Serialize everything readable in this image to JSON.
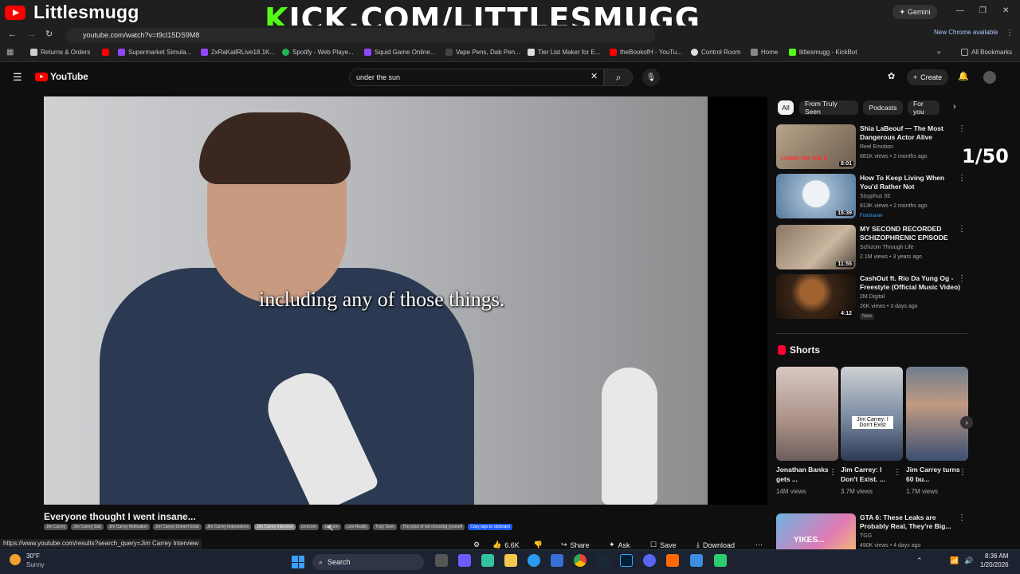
{
  "overlay": {
    "streamer": "Littlesmugg",
    "kick_prefix": "K",
    "kick_rest": "ICK.COM/LITTLESMUGG",
    "counter": "1/50"
  },
  "browser": {
    "url": "youtube.com/watch?v=t9cl15DS9M8",
    "gemini": "Gemini",
    "new_chrome": "New Chrome available",
    "all_bookmarks": "All Bookmarks",
    "bookmarks": [
      "Returns & Orders",
      "Supermarket Simula...",
      "2xRaKailRLive18.1K...",
      "Spotify - Web Playe...",
      "Squid Game Online...",
      "Vape Pens, Dab Pen...",
      "Tier List Maker for E...",
      "theBookofH - YouTu...",
      "Control Room",
      "Home",
      "littlesmugg - KickBot"
    ]
  },
  "youtube": {
    "logo": "YouTube",
    "search_value": "under the sun",
    "create_label": "Create",
    "subtitle": "including any of those things.",
    "video_title": "Everyone thought I went insane...",
    "tags": [
      "Jim Carrey",
      "Jim Carrey Sad",
      "Jim Carrey Motivation",
      "Jim Carrey Doesn't Exist",
      "Jim Carrey Impressions",
      "Jim Carrey Interview",
      "corecore",
      "sadcore",
      "Lost Reality",
      "Truly Seen",
      "The price of not choosing yourself",
      "Copy tags to clipboard"
    ],
    "status_url": "https://www.youtube.com/results?search_query=Jim Carrey Interview",
    "likes": "6.6K",
    "share": "Share",
    "ask": "Ask",
    "save": "Save",
    "download": "Download",
    "chips": [
      "All",
      "From Truly Seen",
      "Podcasts",
      "For you"
    ],
    "recs": [
      {
        "title": "Shia LaBeouf — The Most Dangerous Actor Alive",
        "channel": "Reel Emotion",
        "meta": "681K views • 2 months ago",
        "duration": "8:01",
        "badge": "",
        "thumb_text": "LIVING ON THE E"
      },
      {
        "title": "How To Keep Living When You'd Rather Not",
        "channel": "Sisyphus 55",
        "meta": "813K views • 2 months ago",
        "duration": "15:39",
        "badge": "Fundraiser",
        "thumb_text": ""
      },
      {
        "title": "MY SECOND RECORDED SCHIZOPHRENIC EPISODE",
        "channel": "Schizoin Through Life",
        "meta": "2.1M views • 3 years ago",
        "duration": "11:55",
        "badge": "",
        "thumb_text": ""
      },
      {
        "title": "CashOut ft. Rio Da Yung Og - Freestyle (Official Music Video)",
        "channel": "2M Digital",
        "meta": "26K views • 3 days ago",
        "duration": "4:12",
        "badge": "New",
        "thumb_text": ""
      }
    ],
    "shorts_heading": "Shorts",
    "shorts": [
      {
        "title": "Jonathan Banks gets ...",
        "views": "14M views",
        "overlay": ""
      },
      {
        "title": "Jim Carrey: I Don't Exist. ...",
        "views": "3.7M views",
        "overlay": "Jim Carrey: I Don't Exist"
      },
      {
        "title": "Jim Carrey turns 60 bu...",
        "views": "1.7M views",
        "overlay": ""
      }
    ],
    "last_rec": {
      "title": "GTA 6: These Leaks are Probably Real, They're Big...",
      "channel": "TGG",
      "meta": "490K views • 4 days ago",
      "thumb_text": "YIKES..."
    }
  },
  "taskbar": {
    "weather_temp": "30°F",
    "weather_desc": "Sunny",
    "search": "Search",
    "time": "8:36 AM",
    "date": "1/20/2026"
  },
  "colors": {
    "yt_red": "#ff0000",
    "kick_green": "#53fc18",
    "link_blue": "#3ea6ff"
  }
}
